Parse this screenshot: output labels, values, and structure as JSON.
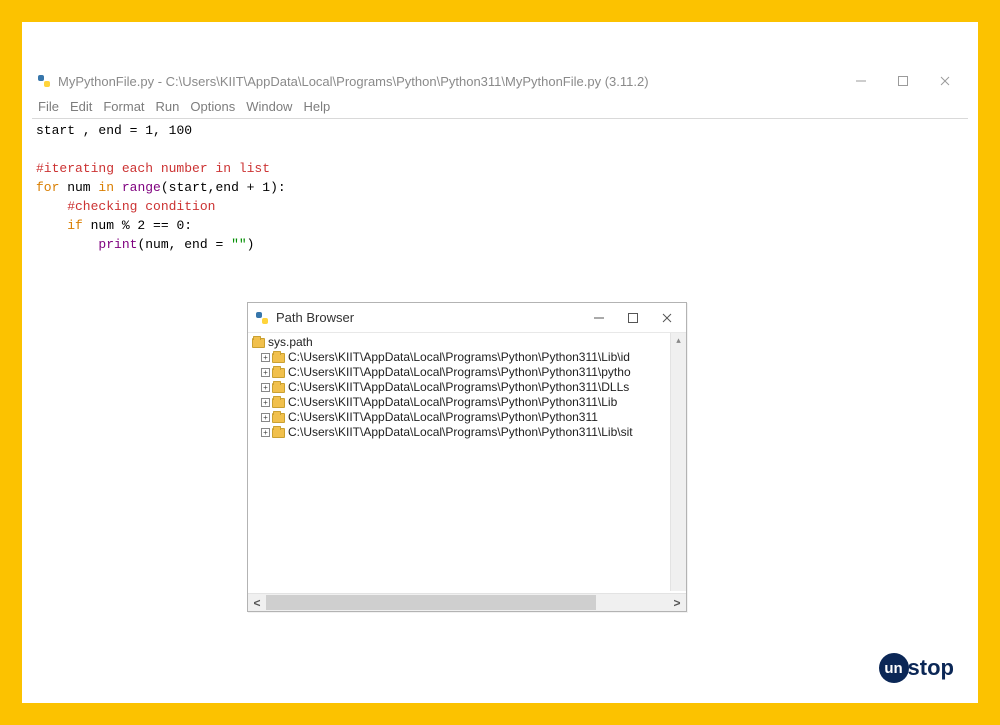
{
  "main_window": {
    "title": "MyPythonFile.py - C:\\Users\\KIIT\\AppData\\Local\\Programs\\Python\\Python311\\MyPythonFile.py (3.11.2)",
    "menu": [
      "File",
      "Edit",
      "Format",
      "Run",
      "Options",
      "Window",
      "Help"
    ]
  },
  "code": {
    "line1a": "start , end = ",
    "line1b": "1",
    "line1c": ", ",
    "line1d": "100",
    "line3": "#iterating each number in list",
    "line4_for": "for",
    "line4_a": " num ",
    "line4_in": "in",
    "line4_b": " ",
    "line4_range": "range",
    "line4_c": "(start,end + ",
    "line4_d": "1",
    "line4_e": "):",
    "line5": "    #checking condition",
    "line6_if": "    if",
    "line6_a": " num % ",
    "line6_b": "2",
    "line6_c": " == ",
    "line6_d": "0",
    "line6_e": ":",
    "line7_a": "        ",
    "line7_print": "print",
    "line7_b": "(num, end = ",
    "line7_str": "\"\"",
    "line7_c": ")"
  },
  "path_browser": {
    "title": "Path Browser",
    "root": "sys.path",
    "items": [
      "C:\\Users\\KIIT\\AppData\\Local\\Programs\\Python\\Python311\\Lib\\id",
      "C:\\Users\\KIIT\\AppData\\Local\\Programs\\Python\\Python311\\pytho",
      "C:\\Users\\KIIT\\AppData\\Local\\Programs\\Python\\Python311\\DLLs",
      "C:\\Users\\KIIT\\AppData\\Local\\Programs\\Python\\Python311\\Lib",
      "C:\\Users\\KIIT\\AppData\\Local\\Programs\\Python\\Python311",
      "C:\\Users\\KIIT\\AppData\\Local\\Programs\\Python\\Python311\\Lib\\sit"
    ]
  },
  "logo": {
    "circle": "un",
    "rest": "stop"
  }
}
